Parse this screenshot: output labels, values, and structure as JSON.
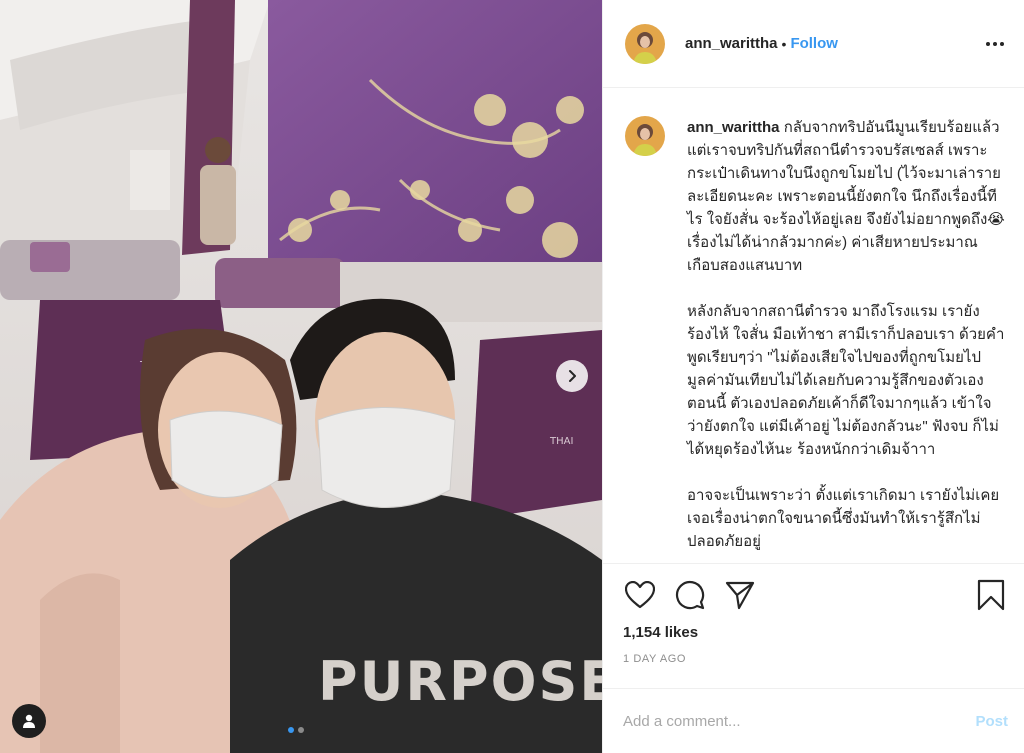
{
  "post": {
    "username": "ann_warittha",
    "separator": "•",
    "follow_label": "Follow",
    "more_icon": "more-options-icon",
    "caption_paragraphs": [
      "กลับจากทริปอันนีมูนเรียบร้อยแล้ว แต่เราจบทริปกันที่สถานีตำรวจบรัสเซลส์ เพราะกระเป๋าเดินทางใบนึงถูกขโมยไป (ไว้จะมาเล่ารายละเอียดนะคะ เพราะตอนนี้ยังตกใจ นึกถึงเรื่องนี้ทีไร ใจยังสั่น จะร้องไห้อยู่เลย จึงยังไม่อยากพูดถึง😭 เรื่องไม่ได้น่ากลัวมากค่ะ) ค่าเสียหายประมาณเกือบสองแสนบาท",
      "หลังกลับจากสถานีตำรวจ มาถึงโรงแรม เรายังร้องไห้ ใจสั่น มือเท้าชา สามีเราก็ปลอบเรา ด้วยคำพูดเรียบๆว่า \"ไม่ต้องเสียใจไปของที่ถูกขโมยไป มูลค่ามันเทียบไม่ได้เลยกับความรู้สึกของตัวเองตอนนี้ ตัวเองปลอดภัยเค้าก็ดีใจมากๆแล้ว เข้าใจว่ายังตกใจ แต่มีเค้าอยู่ ไม่ต้องกลัวนะ\" ฟังจบ ก็ไม่ได้หยุดร้องไห้นะ ร้องหนักกว่าเดิมจ้าาา",
      "อาจจะเป็นเพราะว่า ตั้งแต่เราเกิดมา เรายังไม่เคยเจอเรื่องน่าตกใจขนาดนี้ซึ่งมันทำให้เรารู้สึกไม่ปลอดภัยอยู่"
    ],
    "likes": "1,154 likes",
    "timestamp": "1 DAY AGO",
    "comment_placeholder": "Add a comment...",
    "post_button": "Post",
    "photo": {
      "tail_text": "THAI",
      "hoodie_text": "PURPOSE"
    },
    "carousel": {
      "total_slides": 2,
      "current_slide": 1
    },
    "colors": {
      "accent": "#3897f0",
      "post_disabled": "#b2dffc",
      "seat_purple": "#5e2f55",
      "wall_purple": "#7a4a8f"
    }
  }
}
